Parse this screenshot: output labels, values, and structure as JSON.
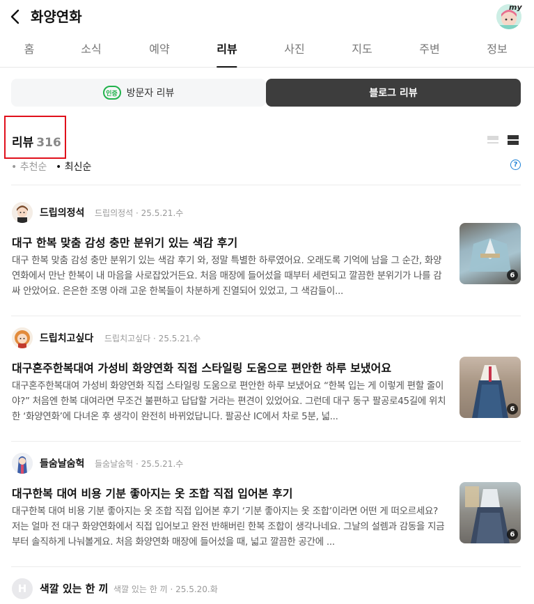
{
  "header": {
    "title": "화양연화",
    "my_label": "my"
  },
  "tabs": [
    "홈",
    "소식",
    "예약",
    "리뷰",
    "사진",
    "지도",
    "주변",
    "정보"
  ],
  "active_tab": "리뷰",
  "segments": {
    "visitor": "방문자 리뷰",
    "cert_label": "인증",
    "blog": "블로그 리뷰"
  },
  "review_header": {
    "label": "리뷰",
    "count": "316",
    "sort_recommended": "• 추천순",
    "sort_latest": "• 최신순",
    "help": "?"
  },
  "reviews": [
    {
      "author": "드립의정석",
      "meta": "드립의정석 · 25.5.21.수",
      "title": "대구 한복 맞춤 감성 충만 분위기 있는 색감 후기",
      "excerpt": "대구 한복 맞춤 감성 충만 분위기 있는 색감 후기 와, 정말 특별한 하루였어요. 오래도록 기억에 남을 그 순간, 화양연화에서 만난 한복이 내 마음을 사로잡았거든요. 처음 매장에 들어섰을 때부터 세련되고 깔끔한 분위기가 나를 감싸 안았어요. 은은한 조명 아래 고운 한복들이 차분하게 진열되어 있었고, 그 색감들이...",
      "photo_count": "6"
    },
    {
      "author": "드립치고싶다",
      "meta": "드립치고싶다 · 25.5.21.수",
      "title": "대구혼주한복대여 가성비 화양연화 직접 스타일링 도움으로 편안한 하루 보냈어요",
      "excerpt": "대구혼주한복대여 가성비 화양연화 직접 스타일링 도움으로 편안한 하루 보냈어요 “한복 입는 게 이렇게 편할 줄이야?” 처음엔 한복 대여라면 무조건 불편하고 답답할 거라는 편견이 있었어요. 그런데 대구 동구 팔공로45길에 위치한 ‘화양연화’에 다녀온 후 생각이 완전히 바뀌었답니다. 팔공산 IC에서 차로 5분, 넓...",
      "photo_count": "6"
    },
    {
      "author": "들숨날숨헉",
      "meta": "들숨날숨헉 · 25.5.21.수",
      "title": "대구한복 대여 비용 기분 좋아지는 옷 조합 직접 입어본 후기",
      "excerpt": "대구한복 대여 비용 기분 좋아지는 옷 조합 직접 입어본 후기 ‘기분 좋아지는 옷 조합’이라면 어떤 게 떠오르세요? 저는 얼마 전 대구 화양연화에서 직접 입어보고 완전 반해버린 한복 조합이 생각나네요. 그날의 설렘과 감동을 지금부터 솔직하게 나눠볼게요. 처음 화양연화 매장에 들어섰을 때, 넓고 깔끔한 공간에 ...",
      "photo_count": "6"
    },
    {
      "author": "색깔 있는 한 끼",
      "meta": "색깔 있는 한 끼 · 25.5.20.화",
      "avatar_letter": "H"
    }
  ],
  "colors": {
    "accent_green": "#22b24c",
    "segment_active": "#3d3d3d",
    "highlight_red": "#e0101b",
    "help_blue": "#1a7fd6"
  }
}
